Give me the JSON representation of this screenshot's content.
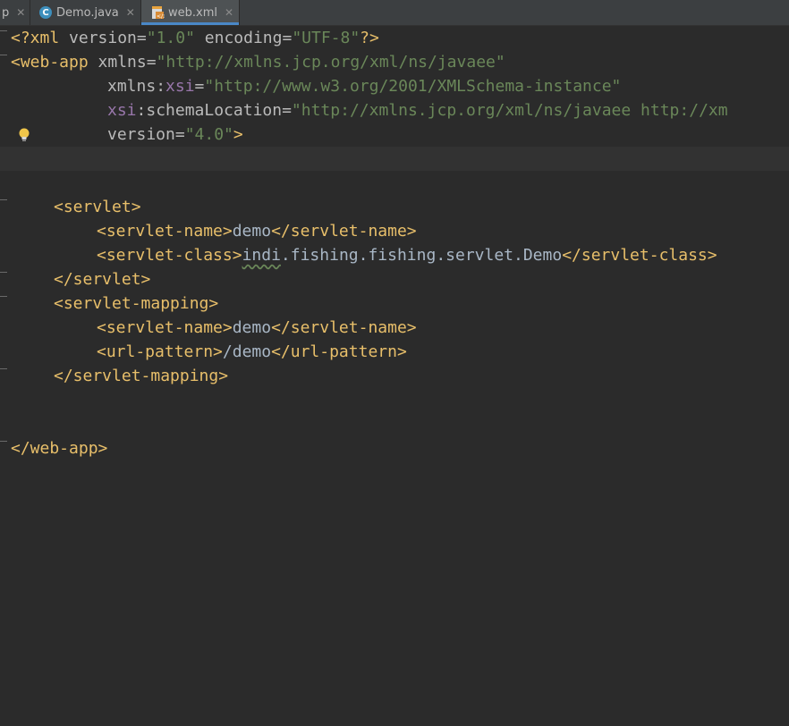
{
  "tabs": [
    {
      "label": "p",
      "active": false
    },
    {
      "label": "Demo.java",
      "active": false,
      "icon": "java-class-icon"
    },
    {
      "label": "web.xml",
      "active": true,
      "icon": "xml-file-icon"
    }
  ],
  "code": {
    "xml_decl": {
      "open": "<?xml",
      "version_attr": "version",
      "version_val": "\"1.0\"",
      "encoding_attr": "encoding",
      "encoding_val": "\"UTF-8\"",
      "close": "?>"
    },
    "webapp_open": {
      "tag": "<web-app",
      "xmlns_attr": "xmlns",
      "xmlns_val": "\"http://xmlns.jcp.org/xml/ns/javaee\""
    },
    "xsi_line": {
      "prefix": "xmlns",
      "colon": ":",
      "name": "xsi",
      "eq": "=",
      "val": "\"http://www.w3.org/2001/XMLSchema-instance\""
    },
    "schema_line": {
      "prefix": "xsi",
      "colon": ":",
      "name": "schemaLocation",
      "eq": "=",
      "val": "\"http://xmlns.jcp.org/xml/ns/javaee http://xm"
    },
    "version_line": {
      "attr": "version",
      "eq": "=",
      "val": "\"4.0\"",
      "close": ">"
    },
    "servlet_open": "<servlet>",
    "servlet_name_open": "<servlet-name>",
    "servlet_name_value": "demo",
    "servlet_name_close": "</servlet-name>",
    "servlet_class_open": "<servlet-class>",
    "servlet_class_value_pkg": "indi",
    "servlet_class_value_rest": ".fishing.fishing.servlet.Demo",
    "servlet_class_close": "</servlet-class>",
    "servlet_close": "</servlet>",
    "mapping_open": "<servlet-mapping>",
    "mapping_name_open": "<servlet-name>",
    "mapping_name_value": "demo",
    "mapping_name_close": "</servlet-name>",
    "url_open": "<url-pattern>",
    "url_value": "/demo",
    "url_close": "</url-pattern>",
    "mapping_close": "</servlet-mapping>",
    "webapp_close": "</web-app>"
  },
  "colors": {
    "background": "#2b2b2b",
    "tag": "#e8bf6a",
    "attribute": "#bababa",
    "namespace": "#9876aa",
    "string": "#6a8759",
    "text": "#a9b7c6",
    "tab_accent": "#4a88c7"
  }
}
